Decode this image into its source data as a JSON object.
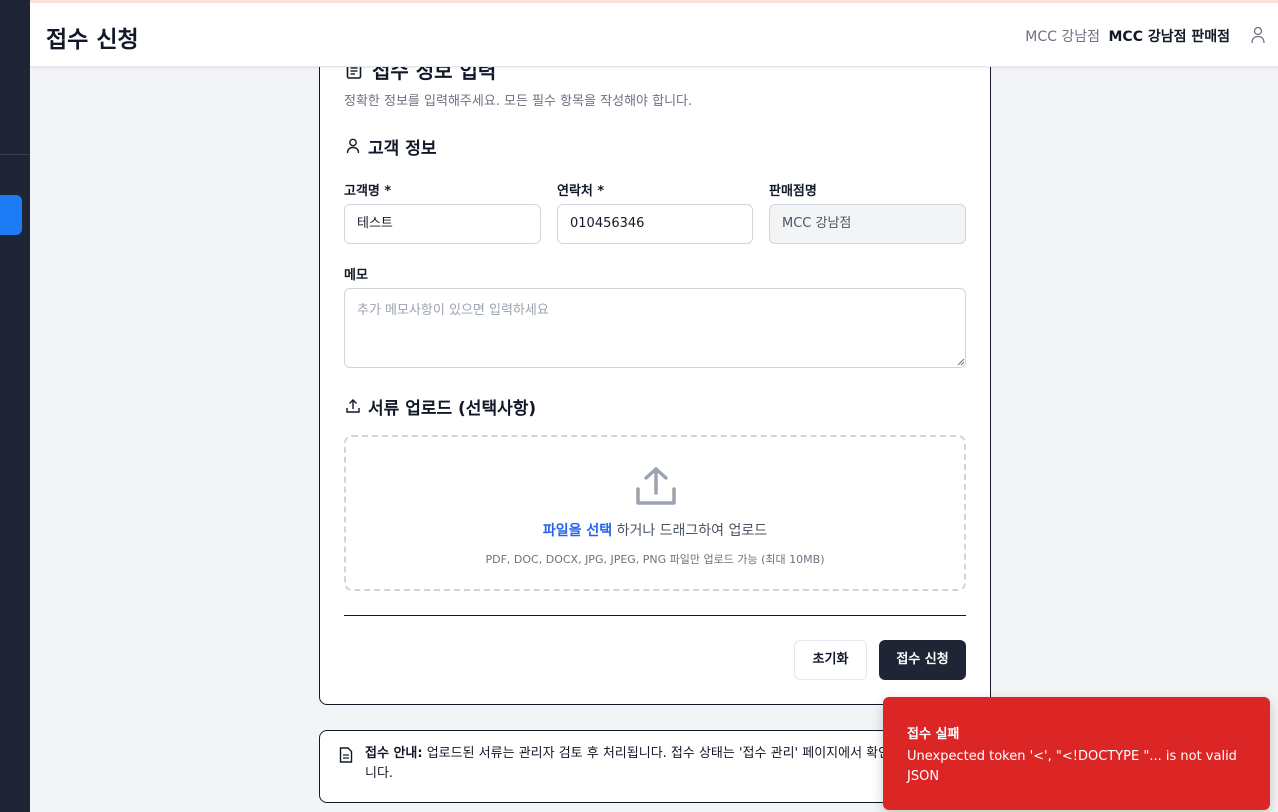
{
  "header": {
    "title": "접수 신청",
    "store": "MCC 강남점",
    "store_user": "MCC 강남점 판매점"
  },
  "form": {
    "heading": "접수 정보 입력",
    "subheading": "정확한 정보를 입력해주세요. 모든 필수 항목을 작성해야 합니다.",
    "customer_section": "고객 정보",
    "name_label": "고객명 *",
    "name_value": "테스트",
    "phone_label": "연락처 *",
    "phone_value": "010456346",
    "store_label": "판매점명",
    "store_value": "MCC 강남점",
    "memo_label": "메모",
    "memo_placeholder": "추가 메모사항이 있으면 입력하세요",
    "upload_section": "서류 업로드 (선택사항)",
    "upload_link": "파일을 선택",
    "upload_text": " 하거나 드래그하여 업로드",
    "upload_hint": "PDF, DOC, DOCX, JPG, JPEG, PNG 파일만 업로드 가능 (최대 10MB)",
    "reset_label": "초기화",
    "submit_label": "접수 신청"
  },
  "notice": {
    "title": "접수 안내:",
    "text": " 업로드된 서류는 관리자 검토 후 처리됩니다. 접수 상태는 '접수 관리' 페이지에서 확인하실 수 있습니다."
  },
  "toast": {
    "title": "접수 실패",
    "message": "Unexpected token '<', \"<!DOCTYPE \"... is not valid JSON",
    "color": "#dc2626"
  },
  "colors": {
    "sidebar": "#1f2534",
    "accent": "#1e7bf6",
    "link": "#2563eb"
  }
}
